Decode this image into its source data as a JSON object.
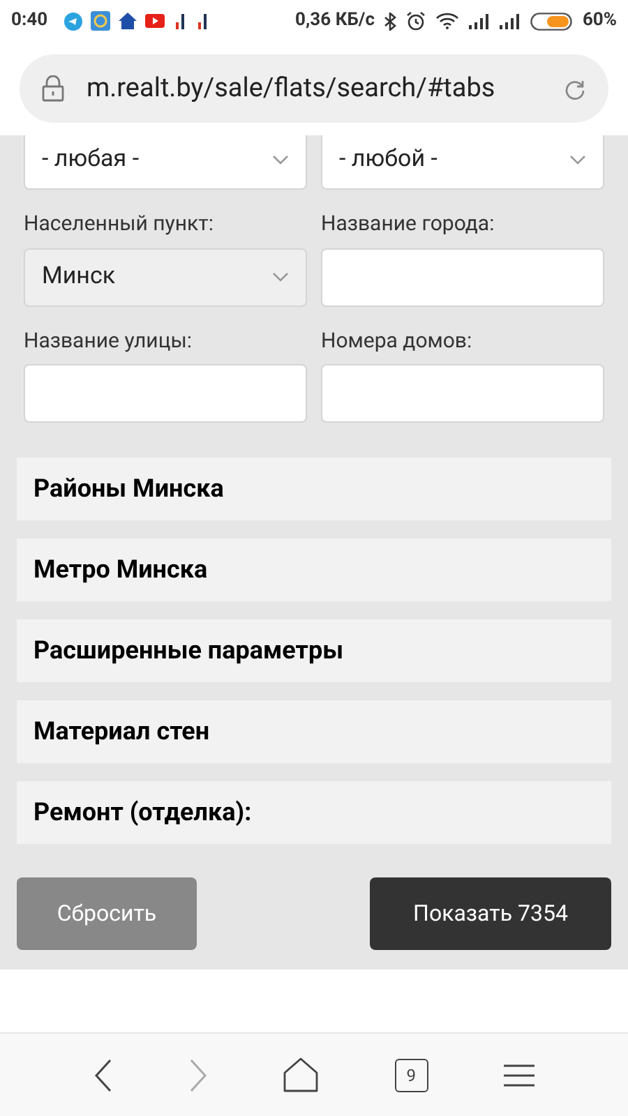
{
  "status_bar": {
    "time": "0:40",
    "speed": "0,36 КБ/с",
    "battery": "60%"
  },
  "address_bar": {
    "url": "m.realt.by/sale/flats/search/#tabs"
  },
  "form": {
    "rows": [
      [
        {
          "kind": "select",
          "value": "- любая -",
          "disabled": false
        },
        {
          "kind": "select",
          "value": "- любой -",
          "disabled": false
        }
      ],
      [
        {
          "kind": "select",
          "label": "Населенный пункт:",
          "value": "Минск",
          "disabled": true
        },
        {
          "kind": "input",
          "label": "Название города:"
        }
      ],
      [
        {
          "kind": "input",
          "label": "Название улицы:"
        },
        {
          "kind": "input",
          "label": "Номера домов:"
        }
      ]
    ]
  },
  "sections": [
    {
      "title": "Районы Минска"
    },
    {
      "title": "Метро Минска"
    },
    {
      "title": "Расширенные параметры"
    },
    {
      "title": "Материал стен"
    },
    {
      "title": "Ремонт (отделка):"
    }
  ],
  "buttons": {
    "reset": "Сбросить",
    "show": "Показать 7354"
  },
  "browser_nav": {
    "tab_count": "9"
  }
}
